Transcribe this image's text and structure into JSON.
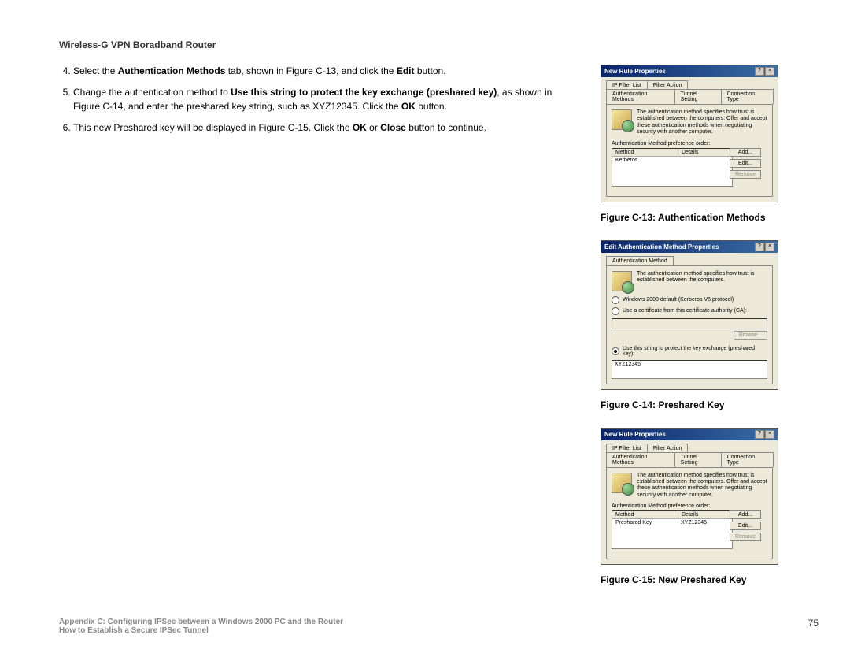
{
  "header": "Wireless-G VPN Boradband Router",
  "steps": {
    "s4_a": "Select the ",
    "s4_b": "Authentication Methods",
    "s4_c": " tab, shown in Figure C-13, and click the ",
    "s4_d": "Edit",
    "s4_e": " button.",
    "s5_a": "Change the authentication method to ",
    "s5_b": "Use this string to protect the key exchange (preshared key)",
    "s5_c": ", as shown in Figure C-14, and enter the preshared key string, such as XYZ12345. Click the ",
    "s5_d": "OK",
    "s5_e": " button.",
    "s6_a": "This new Preshared key will be displayed in Figure C-15. Click the ",
    "s6_b": "OK",
    "s6_c": " or ",
    "s6_d": "Close",
    "s6_e": " button to continue."
  },
  "captions": {
    "c13": "Figure C-13: Authentication Methods",
    "c14": "Figure C-14: Preshared Key",
    "c15": "Figure C-15: New Preshared Key"
  },
  "dialog13": {
    "title": "New Rule Properties",
    "tabs_top": [
      "IP Filter List",
      "Filter Action"
    ],
    "tabs_bot": [
      "Authentication Methods",
      "Tunnel Setting",
      "Connection Type"
    ],
    "desc": "The authentication method specifies how trust is established between the computers. Offer and accept these authentication methods when negotiating security with another computer.",
    "pref": "Authentication Method preference order:",
    "col_method": "Method",
    "col_details": "Details",
    "row_method": "Kerberos",
    "row_details": "",
    "btn_add": "Add...",
    "btn_edit": "Edit...",
    "btn_remove": "Remove"
  },
  "dialog14": {
    "title": "Edit Authentication Method Properties",
    "tab": "Authentication Method",
    "desc": "The authentication method specifies how trust is established between the computers.",
    "opt1": "Windows 2000 default (Kerberos V5 protocol)",
    "opt2": "Use a certificate from this certificate authority (CA):",
    "browse": "Browse...",
    "opt3": "Use this string to protect the key exchange (preshared key):",
    "key": "XYZ12345"
  },
  "dialog15": {
    "title": "New Rule Properties",
    "tabs_top": [
      "IP Filter List",
      "Filter Action"
    ],
    "tabs_bot": [
      "Authentication Methods",
      "Tunnel Setting",
      "Connection Type"
    ],
    "desc": "The authentication method specifies how trust is established between the computers. Offer and accept these authentication methods when negotiating security with another computer.",
    "pref": "Authentication Method preference order:",
    "col_method": "Method",
    "col_details": "Details",
    "row_method": "Preshared Key",
    "row_details": "XYZ12345",
    "btn_add": "Add...",
    "btn_edit": "Edit...",
    "btn_remove": "Remove"
  },
  "footer": {
    "line1": "Appendix C: Configuring IPSec between a Windows 2000 PC and the Router",
    "line2": "How to Establish a Secure IPSec Tunnel",
    "page": "75"
  }
}
